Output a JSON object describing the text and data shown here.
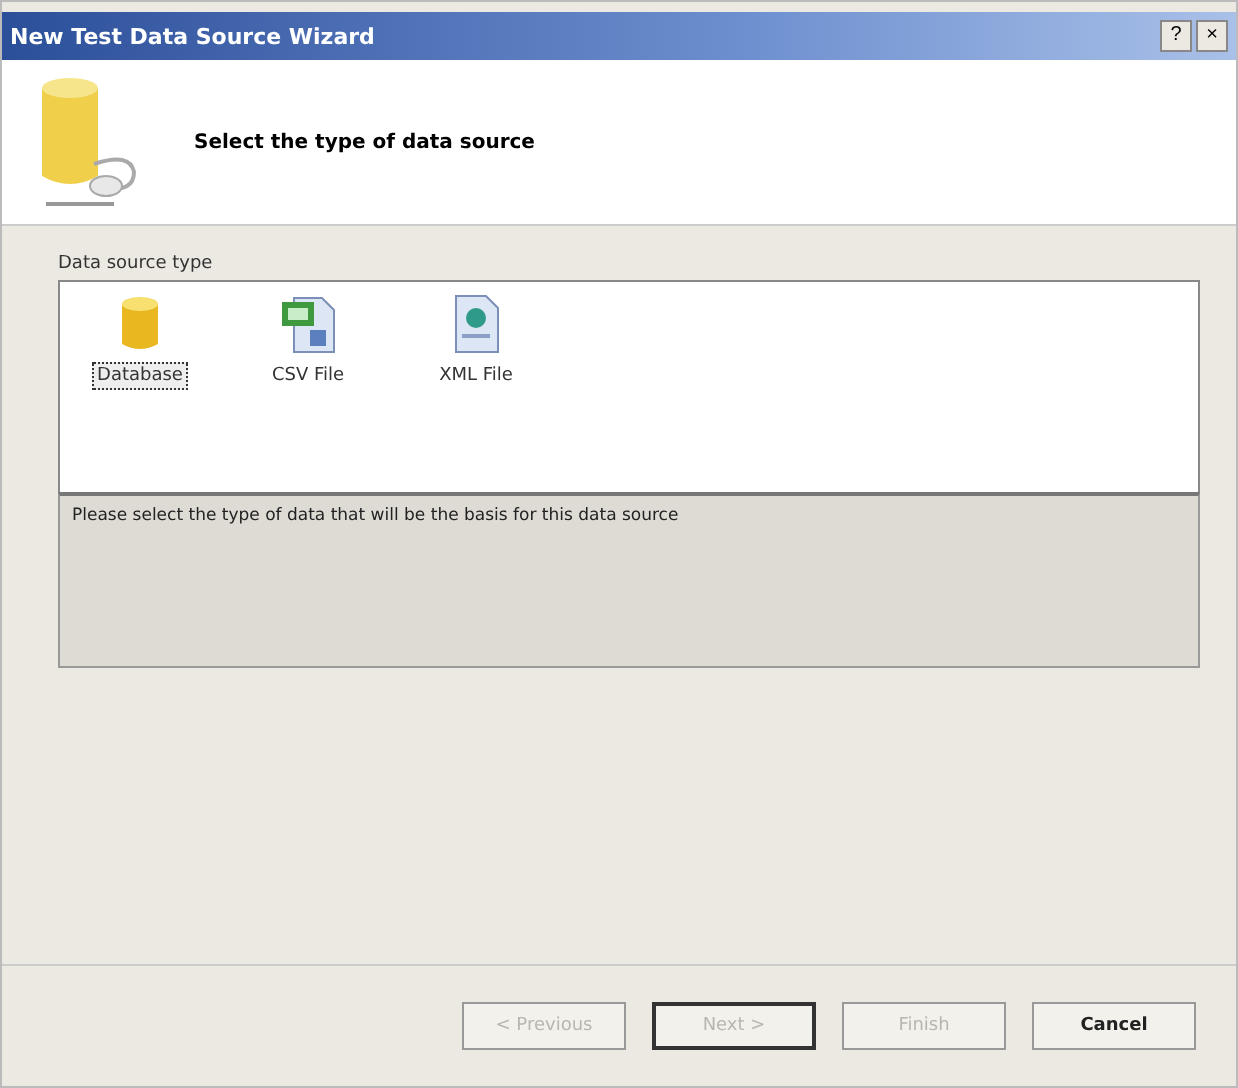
{
  "window": {
    "title": "New Test Data Source Wizard",
    "controls": [
      "?",
      "×"
    ]
  },
  "header": {
    "title": "Select the type of data source"
  },
  "source_type": {
    "label": "Data source type",
    "items": [
      {
        "label": "Database",
        "kind": "database",
        "selected": true
      },
      {
        "label": "CSV File",
        "kind": "csv",
        "selected": false
      },
      {
        "label": "XML File",
        "kind": "xml",
        "selected": false
      }
    ]
  },
  "description": "Please select the type of data that will be the basis for this data source",
  "buttons": [
    {
      "label": "< Previous",
      "disabled": true,
      "default": false
    },
    {
      "label": "Next >",
      "disabled": true,
      "default": true
    },
    {
      "label": "Finish",
      "disabled": true,
      "default": false
    },
    {
      "label": "Cancel",
      "disabled": false,
      "default": false
    }
  ]
}
